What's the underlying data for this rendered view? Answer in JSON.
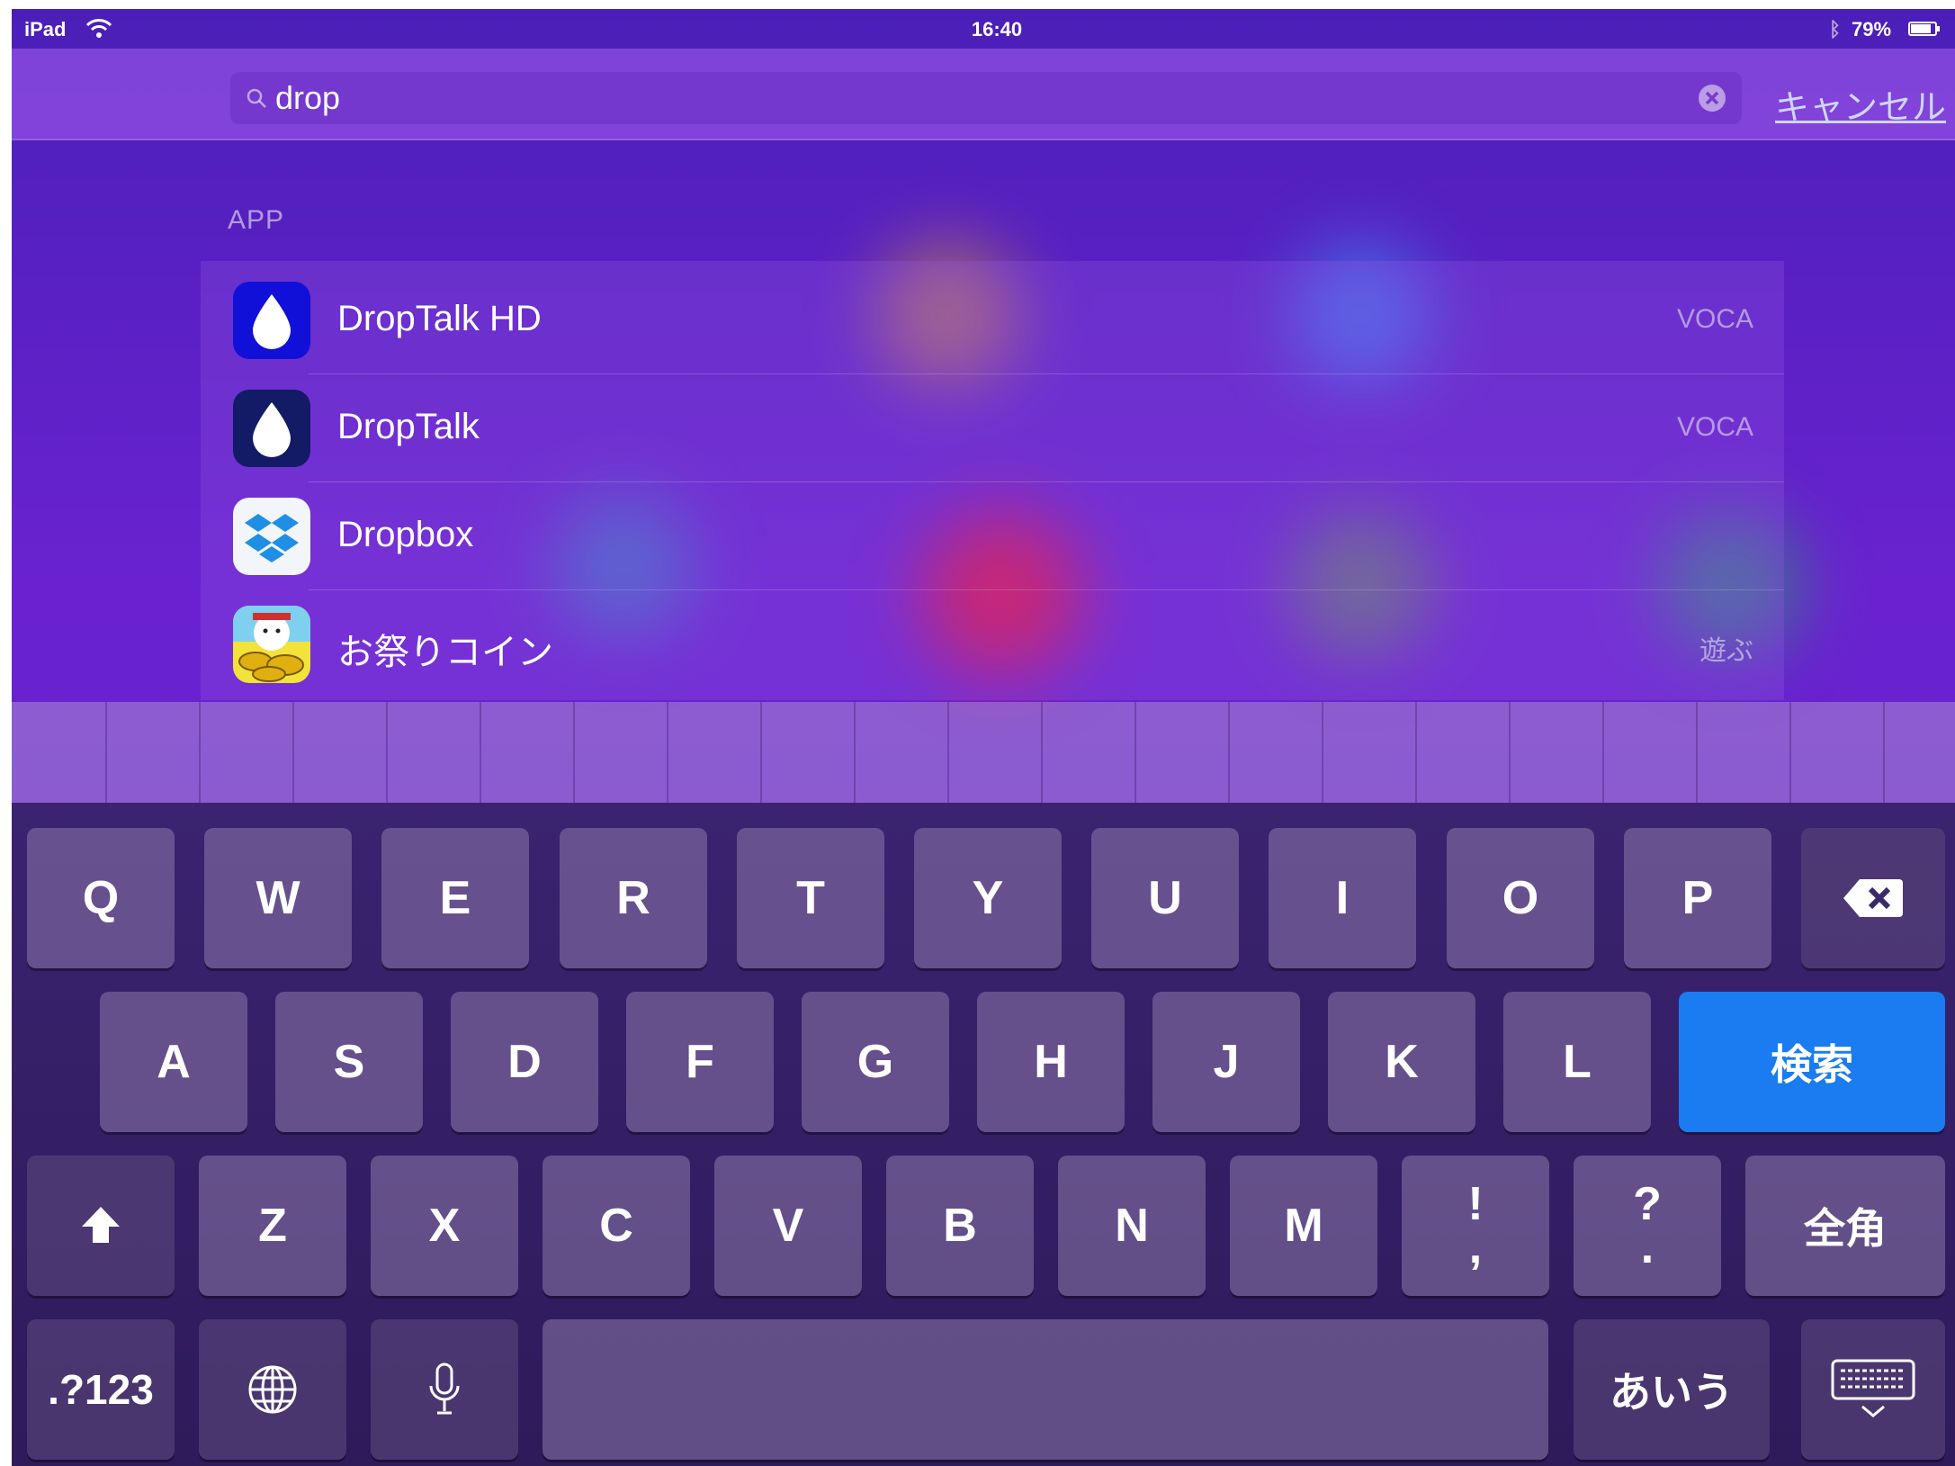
{
  "status_bar": {
    "device": "iPad",
    "time": "16:40",
    "battery_percent": "79%"
  },
  "search": {
    "query": "drop",
    "cancel_label": "キャンセル"
  },
  "results": {
    "section_label": "APP",
    "items": [
      {
        "name": "DropTalk HD",
        "category": "VOCA",
        "icon": "droptalk-hd-icon"
      },
      {
        "name": "DropTalk",
        "category": "VOCA",
        "icon": "droptalk-icon"
      },
      {
        "name": "Dropbox",
        "category": "",
        "icon": "dropbox-icon"
      },
      {
        "name": "お祭りコイン",
        "category": "遊ぶ",
        "icon": "omatsuri-coin-icon"
      }
    ]
  },
  "keyboard": {
    "row1": [
      "Q",
      "W",
      "E",
      "R",
      "T",
      "Y",
      "U",
      "I",
      "O",
      "P"
    ],
    "row2": [
      "A",
      "S",
      "D",
      "F",
      "G",
      "H",
      "J",
      "K",
      "L"
    ],
    "row3": [
      "Z",
      "X",
      "C",
      "V",
      "B",
      "N",
      "M"
    ],
    "punct1_top": "!",
    "punct1_bottom": ",",
    "punct2_top": "?",
    "punct2_bottom": ".",
    "search_label": "検索",
    "zenkaku_label": "全角",
    "numbers_label": ".?123",
    "kana_label": "あいう"
  },
  "colors": {
    "accent_blue": "#1a7cf0",
    "background_purple": "#5b1fc4"
  }
}
